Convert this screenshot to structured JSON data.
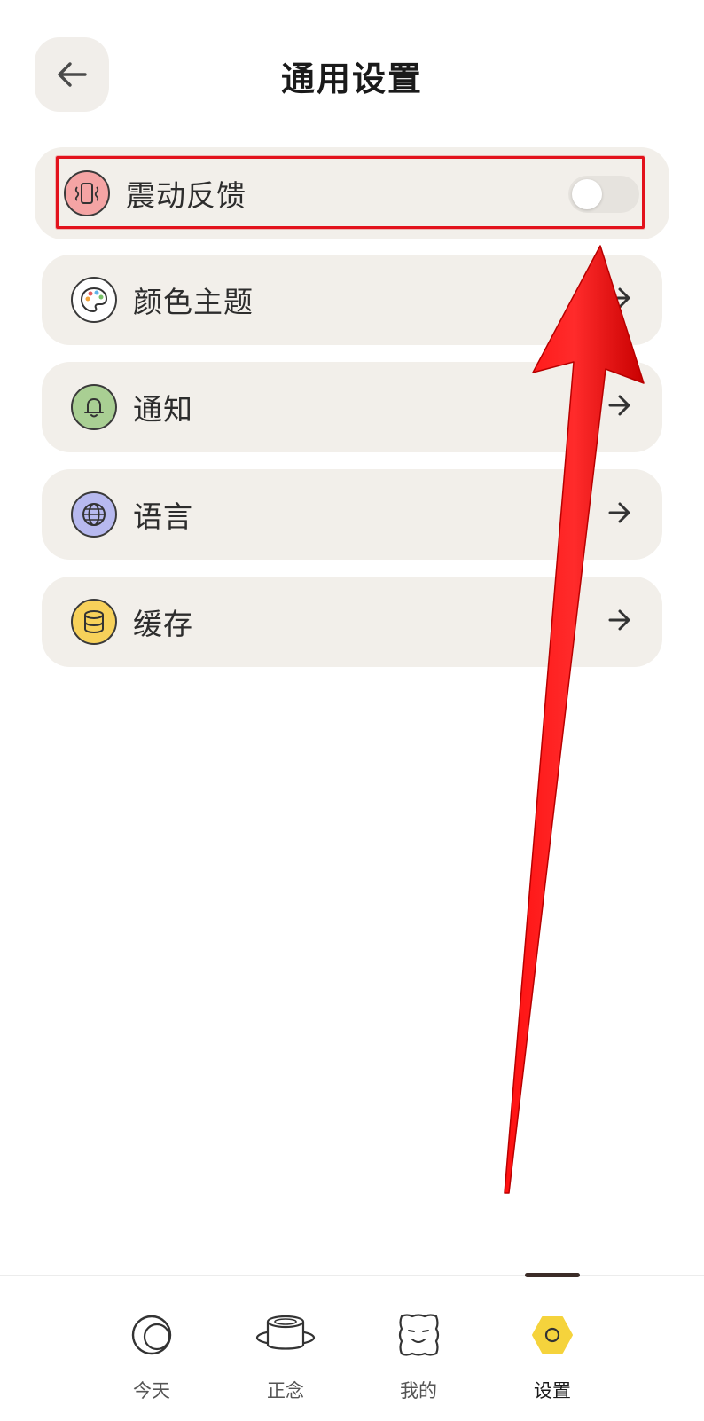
{
  "header": {
    "title": "通用设置"
  },
  "settings": [
    {
      "label": "震动反馈",
      "icon": "vibration-icon",
      "type": "toggle",
      "enabled": false
    },
    {
      "label": "颜色主题",
      "icon": "palette-icon",
      "type": "link"
    },
    {
      "label": "通知",
      "icon": "bell-icon",
      "type": "link"
    },
    {
      "label": "语言",
      "icon": "globe-icon",
      "type": "link"
    },
    {
      "label": "缓存",
      "icon": "database-icon",
      "type": "link"
    }
  ],
  "bottom_nav": {
    "items": [
      {
        "label": "今天",
        "icon": "moon-circle-icon"
      },
      {
        "label": "正念",
        "icon": "drum-icon"
      },
      {
        "label": "我的",
        "icon": "smiley-face-icon"
      },
      {
        "label": "设置",
        "icon": "hexagon-icon",
        "active": true
      }
    ]
  },
  "colors": {
    "card_bg": "#f2efea",
    "highlight": "#e3121c",
    "vibration_icon_bg": "#f4a4a4",
    "bell_icon_bg": "#a9cf93",
    "globe_icon_bg": "#b7b9ef",
    "database_icon_bg": "#f7d15a",
    "settings_tab_icon": "#f5d33c"
  }
}
